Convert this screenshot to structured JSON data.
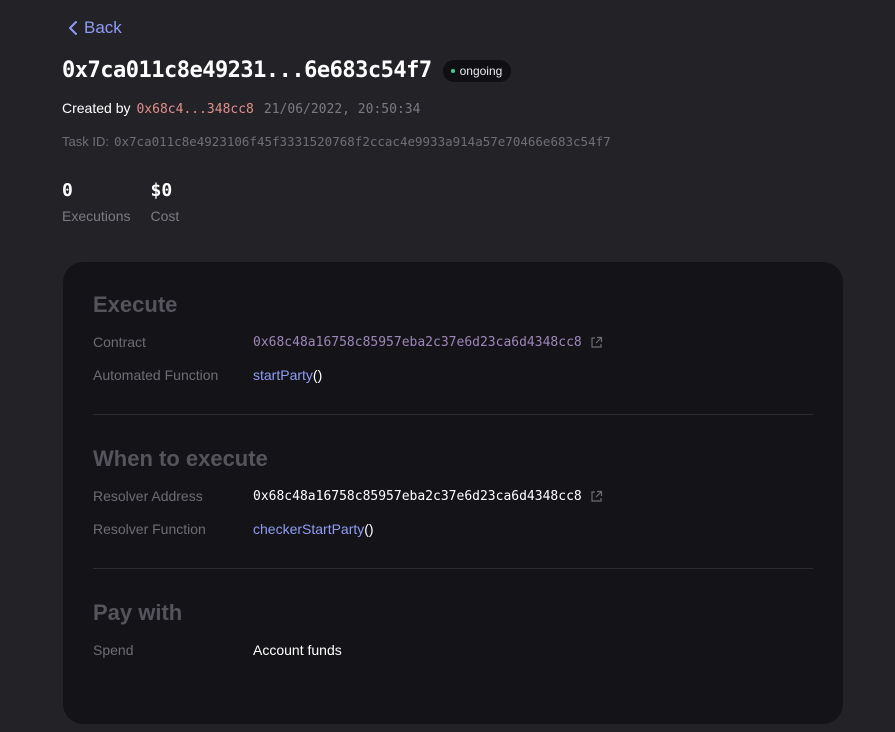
{
  "nav": {
    "back_label": "Back"
  },
  "task": {
    "title": "0x7ca011c8e49231...6e683c54f7",
    "status": "ongoing",
    "created_by_label": "Created by",
    "creator": "0x68c4...348cc8",
    "created_at": "21/06/2022, 20:50:34",
    "task_id_label": "Task ID:",
    "task_id": "0x7ca011c8e4923106f45f3331520768f2ccac4e9933a914a57e70466e683c54f7"
  },
  "stats": {
    "executions": {
      "value": "0",
      "label": "Executions"
    },
    "cost": {
      "value": "$0",
      "label": "Cost"
    }
  },
  "execute": {
    "title": "Execute",
    "contract_label": "Contract",
    "contract": "0x68c48a16758c85957eba2c37e6d23ca6d4348cc8",
    "function_label": "Automated Function",
    "function_name": "startParty",
    "function_parens": "()"
  },
  "when": {
    "title": "When to execute",
    "resolver_address_label": "Resolver Address",
    "resolver_address": "0x68c48a16758c85957eba2c37e6d23ca6d4348cc8",
    "resolver_function_label": "Resolver Function",
    "resolver_function_name": "checkerStartParty",
    "resolver_function_parens": "()"
  },
  "pay": {
    "title": "Pay with",
    "spend_label": "Spend",
    "spend_value": "Account funds"
  },
  "colors": {
    "background": "#232227",
    "card": "#141418",
    "link": "#8f9bf5",
    "creator": "#e0908a",
    "status_dot": "#46c98a"
  }
}
